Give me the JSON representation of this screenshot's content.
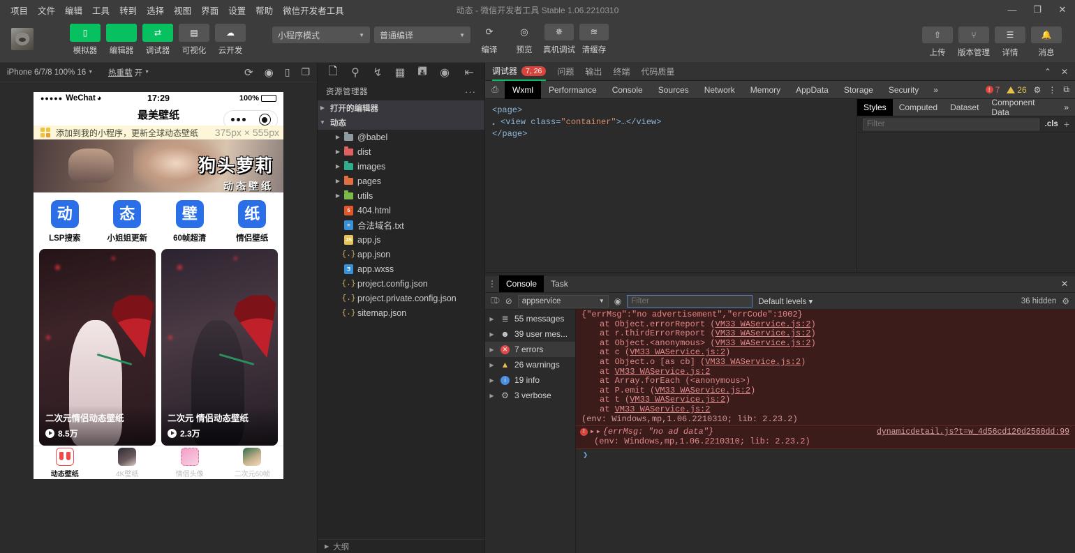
{
  "titlebar": {
    "menus": [
      "项目",
      "文件",
      "编辑",
      "工具",
      "转到",
      "选择",
      "视图",
      "界面",
      "设置",
      "帮助",
      "微信开发者工具"
    ],
    "window_title": "动态 - 微信开发者工具 Stable 1.06.2210310",
    "minimize": "—",
    "maximize": "❐",
    "close": "✕"
  },
  "toolbar": {
    "tools": [
      {
        "label": "模拟器",
        "icon": "phone-icon",
        "glyph": "▯",
        "style": "green"
      },
      {
        "label": "编辑器",
        "icon": "code-icon",
        "glyph": "</>",
        "style": "green"
      },
      {
        "label": "调试器",
        "icon": "debugger-icon",
        "glyph": "⇄",
        "style": "green"
      },
      {
        "label": "可视化",
        "icon": "layout-icon",
        "glyph": "▤",
        "style": "grey"
      },
      {
        "label": "云开发",
        "icon": "cloud-icon",
        "glyph": "☁",
        "style": "grey"
      }
    ],
    "mode_select": "小程序模式",
    "compile_select": "普通编译",
    "actions": [
      {
        "label": "编译",
        "icon": "refresh-icon",
        "glyph": "⟳"
      },
      {
        "label": "预览",
        "icon": "eye-icon",
        "glyph": "◎"
      },
      {
        "label": "真机调试",
        "icon": "bug-icon",
        "glyph": "✵"
      },
      {
        "label": "清缓存",
        "icon": "layers-icon",
        "glyph": "≋"
      }
    ],
    "right_actions": [
      {
        "label": "上传",
        "icon": "upload-icon",
        "glyph": "⇧"
      },
      {
        "label": "版本管理",
        "icon": "branch-icon",
        "glyph": "⑂"
      },
      {
        "label": "详情",
        "icon": "menu-icon",
        "glyph": "☰"
      },
      {
        "label": "消息",
        "icon": "bell-icon",
        "glyph": "🔔"
      }
    ],
    "avatar_alt": "user-avatar"
  },
  "simulator": {
    "device": "iPhone 6/7/8 100% 16",
    "hotreload_label": "热重载",
    "hotreload_value": "开",
    "icons": [
      "refresh-icon",
      "record-icon",
      "rotate-icon",
      "multiscreen-icon"
    ],
    "size_badge": "375px × 555px",
    "phone": {
      "carrier": "WeChat",
      "signal_dots": "●●●●●",
      "wifi": "🛜",
      "time": "17:29",
      "battery_pct": "100%",
      "page_title": "最美壁纸",
      "tip_text": "添加到我的小程序，更新全球动态壁纸",
      "banner": {
        "line1": "狗头萝莉",
        "line2": "动态壁纸"
      },
      "categories": [
        {
          "glyph": "动",
          "name": "LSP搜索"
        },
        {
          "glyph": "态",
          "name": "小姐姐更新"
        },
        {
          "glyph": "壁",
          "name": "60帧超清"
        },
        {
          "glyph": "纸",
          "name": "情侣壁纸"
        }
      ],
      "cards": [
        {
          "title": "二次元情侣动态壁纸",
          "plays": "8.5万"
        },
        {
          "title": "二次元 情侣动态壁纸",
          "plays": "2.3万"
        }
      ],
      "tabs": [
        {
          "label": "动态壁纸",
          "active": true
        },
        {
          "label": "4K壁纸",
          "active": false
        },
        {
          "label": "情侣头像",
          "active": false
        },
        {
          "label": "二次元60帧",
          "active": false
        }
      ]
    }
  },
  "explorer": {
    "icon_bar": [
      "files-icon",
      "search-icon",
      "source-control-icon",
      "extensions-icon",
      "save-icon",
      "debug-icon",
      "collapse-icon"
    ],
    "title": "资源管理器",
    "more": "···",
    "sections": [
      {
        "label": "打开的编辑器",
        "expanded": false
      },
      {
        "label": "动态",
        "expanded": true
      }
    ],
    "folders": [
      {
        "name": "@babel",
        "color": "#8f9ba3"
      },
      {
        "name": "dist",
        "color": "#e06060"
      },
      {
        "name": "images",
        "color": "#2fae8e"
      },
      {
        "name": "pages",
        "color": "#e07040"
      },
      {
        "name": "utils",
        "color": "#7ab84a"
      }
    ],
    "files": [
      {
        "name": "404.html",
        "icon_type": "html",
        "badge": "5",
        "color": "#e2562a"
      },
      {
        "name": "合法域名.txt",
        "icon_type": "txt",
        "badge": "≡",
        "color": "#3a92d6"
      },
      {
        "name": "app.js",
        "icon_type": "js",
        "badge": "JS",
        "color": "#e8c552"
      },
      {
        "name": "app.json",
        "icon_type": "json",
        "badge": "{.}",
        "color": "#d9b25f"
      },
      {
        "name": "app.wxss",
        "icon_type": "wxss",
        "badge": "Ǝ",
        "color": "#3a92d6"
      },
      {
        "name": "project.config.json",
        "icon_type": "json",
        "badge": "{.}",
        "color": "#d9b25f"
      },
      {
        "name": "project.private.config.json",
        "icon_type": "json",
        "badge": "{.}",
        "color": "#d9b25f"
      },
      {
        "name": "sitemap.json",
        "icon_type": "json",
        "badge": "{.}",
        "color": "#d9b25f"
      }
    ],
    "footer": "大纲"
  },
  "debugger": {
    "panel_tabs": [
      {
        "label": "调试器",
        "badge": "7, 26",
        "active": true
      },
      {
        "label": "问题",
        "badge": "",
        "active": false
      },
      {
        "label": "输出",
        "badge": "",
        "active": false
      },
      {
        "label": "终端",
        "badge": "",
        "active": false
      },
      {
        "label": "代码质量",
        "badge": "",
        "active": false
      }
    ],
    "panel_collapse": "⌃",
    "panel_close": "✕",
    "devtools_tabs": [
      "Wxml",
      "Performance",
      "Console",
      "Sources",
      "Network",
      "Memory",
      "AppData",
      "Storage",
      "Security"
    ],
    "devtools_active": "Wxml",
    "devtools_more": "»",
    "error_count": "7",
    "warning_count": "26",
    "settings_icon": "gear-icon",
    "kebab_icon": "kebab-icon",
    "dock_icon": "dock-icon",
    "dom": {
      "line1": "<page>",
      "line2_pre": "<view class=",
      "line2_val": "\"container\"",
      "line2_post": ">…</view>",
      "line3": "</page>"
    },
    "styles_tabs": [
      "Styles",
      "Computed",
      "Dataset",
      "Component Data"
    ],
    "styles_active": "Styles",
    "styles_more": "»",
    "styles_filter_placeholder": "Filter",
    "styles_cls": ".cls",
    "styles_plus": "+"
  },
  "console": {
    "tabs": [
      {
        "label": "Console",
        "active": true
      },
      {
        "label": "Task",
        "active": false
      }
    ],
    "close": "✕",
    "context": "appservice",
    "filter_placeholder": "Filter",
    "levels": "Default levels",
    "hidden": "36 hidden",
    "sidebar": [
      {
        "label": "55 messages",
        "icon": "list-icon",
        "selected": false
      },
      {
        "label": "39 user mes...",
        "icon": "user-icon",
        "selected": false
      },
      {
        "label": "7 errors",
        "icon": "error-icon",
        "selected": true
      },
      {
        "label": "26 warnings",
        "icon": "warning-icon",
        "selected": false
      },
      {
        "label": "19 info",
        "icon": "info-icon",
        "selected": false
      },
      {
        "label": "3 verbose",
        "icon": "verbose-icon",
        "selected": false
      }
    ],
    "log_entry_1": {
      "head": "{\"errMsg\":\"no advertisement\",\"errCode\":1002}",
      "stack": [
        {
          "pre": "at Object.errorReport (",
          "link": "VM33 WAService.js:2",
          "post": ")"
        },
        {
          "pre": "at r.thirdErrorReport (",
          "link": "VM33 WAService.js:2",
          "post": ")"
        },
        {
          "pre": "at Object.<anonymous> (",
          "link": "VM33 WAService.js:2",
          "post": ")"
        },
        {
          "pre": "at c (",
          "link": "VM33 WAService.js:2",
          "post": ")"
        },
        {
          "pre": "at Object.o [as cb] (",
          "link": "VM33 WAService.js:2",
          "post": ")"
        },
        {
          "pre": "at ",
          "link": "VM33 WAService.js:2",
          "post": ""
        },
        {
          "pre": "at Array.forEach (<anonymous>)",
          "link": "",
          "post": ""
        },
        {
          "pre": "at P.emit (",
          "link": "VM33 WAService.js:2",
          "post": ")"
        },
        {
          "pre": "at t (",
          "link": "VM33 WAService.js:2",
          "post": ")"
        },
        {
          "pre": "at ",
          "link": "VM33 WAService.js:2",
          "post": ""
        }
      ],
      "env": "(env: Windows,mp,1.06.2210310; lib: 2.23.2)"
    },
    "log_entry_2": {
      "text": "{errMsg: \"no ad data\"}",
      "source": "dynamicdetail.js?t=w_4d56cd120d2560dd:99",
      "env": "(env: Windows,mp,1.06.2210310; lib: 2.23.2)"
    },
    "prompt": "❯"
  },
  "colors": {
    "accent_green": "#07c160",
    "error_red": "#d9453d",
    "warning_yellow": "#e8c14a",
    "chrome_bg": "#3c3c3c",
    "panel_bg": "#2b2b2b"
  }
}
